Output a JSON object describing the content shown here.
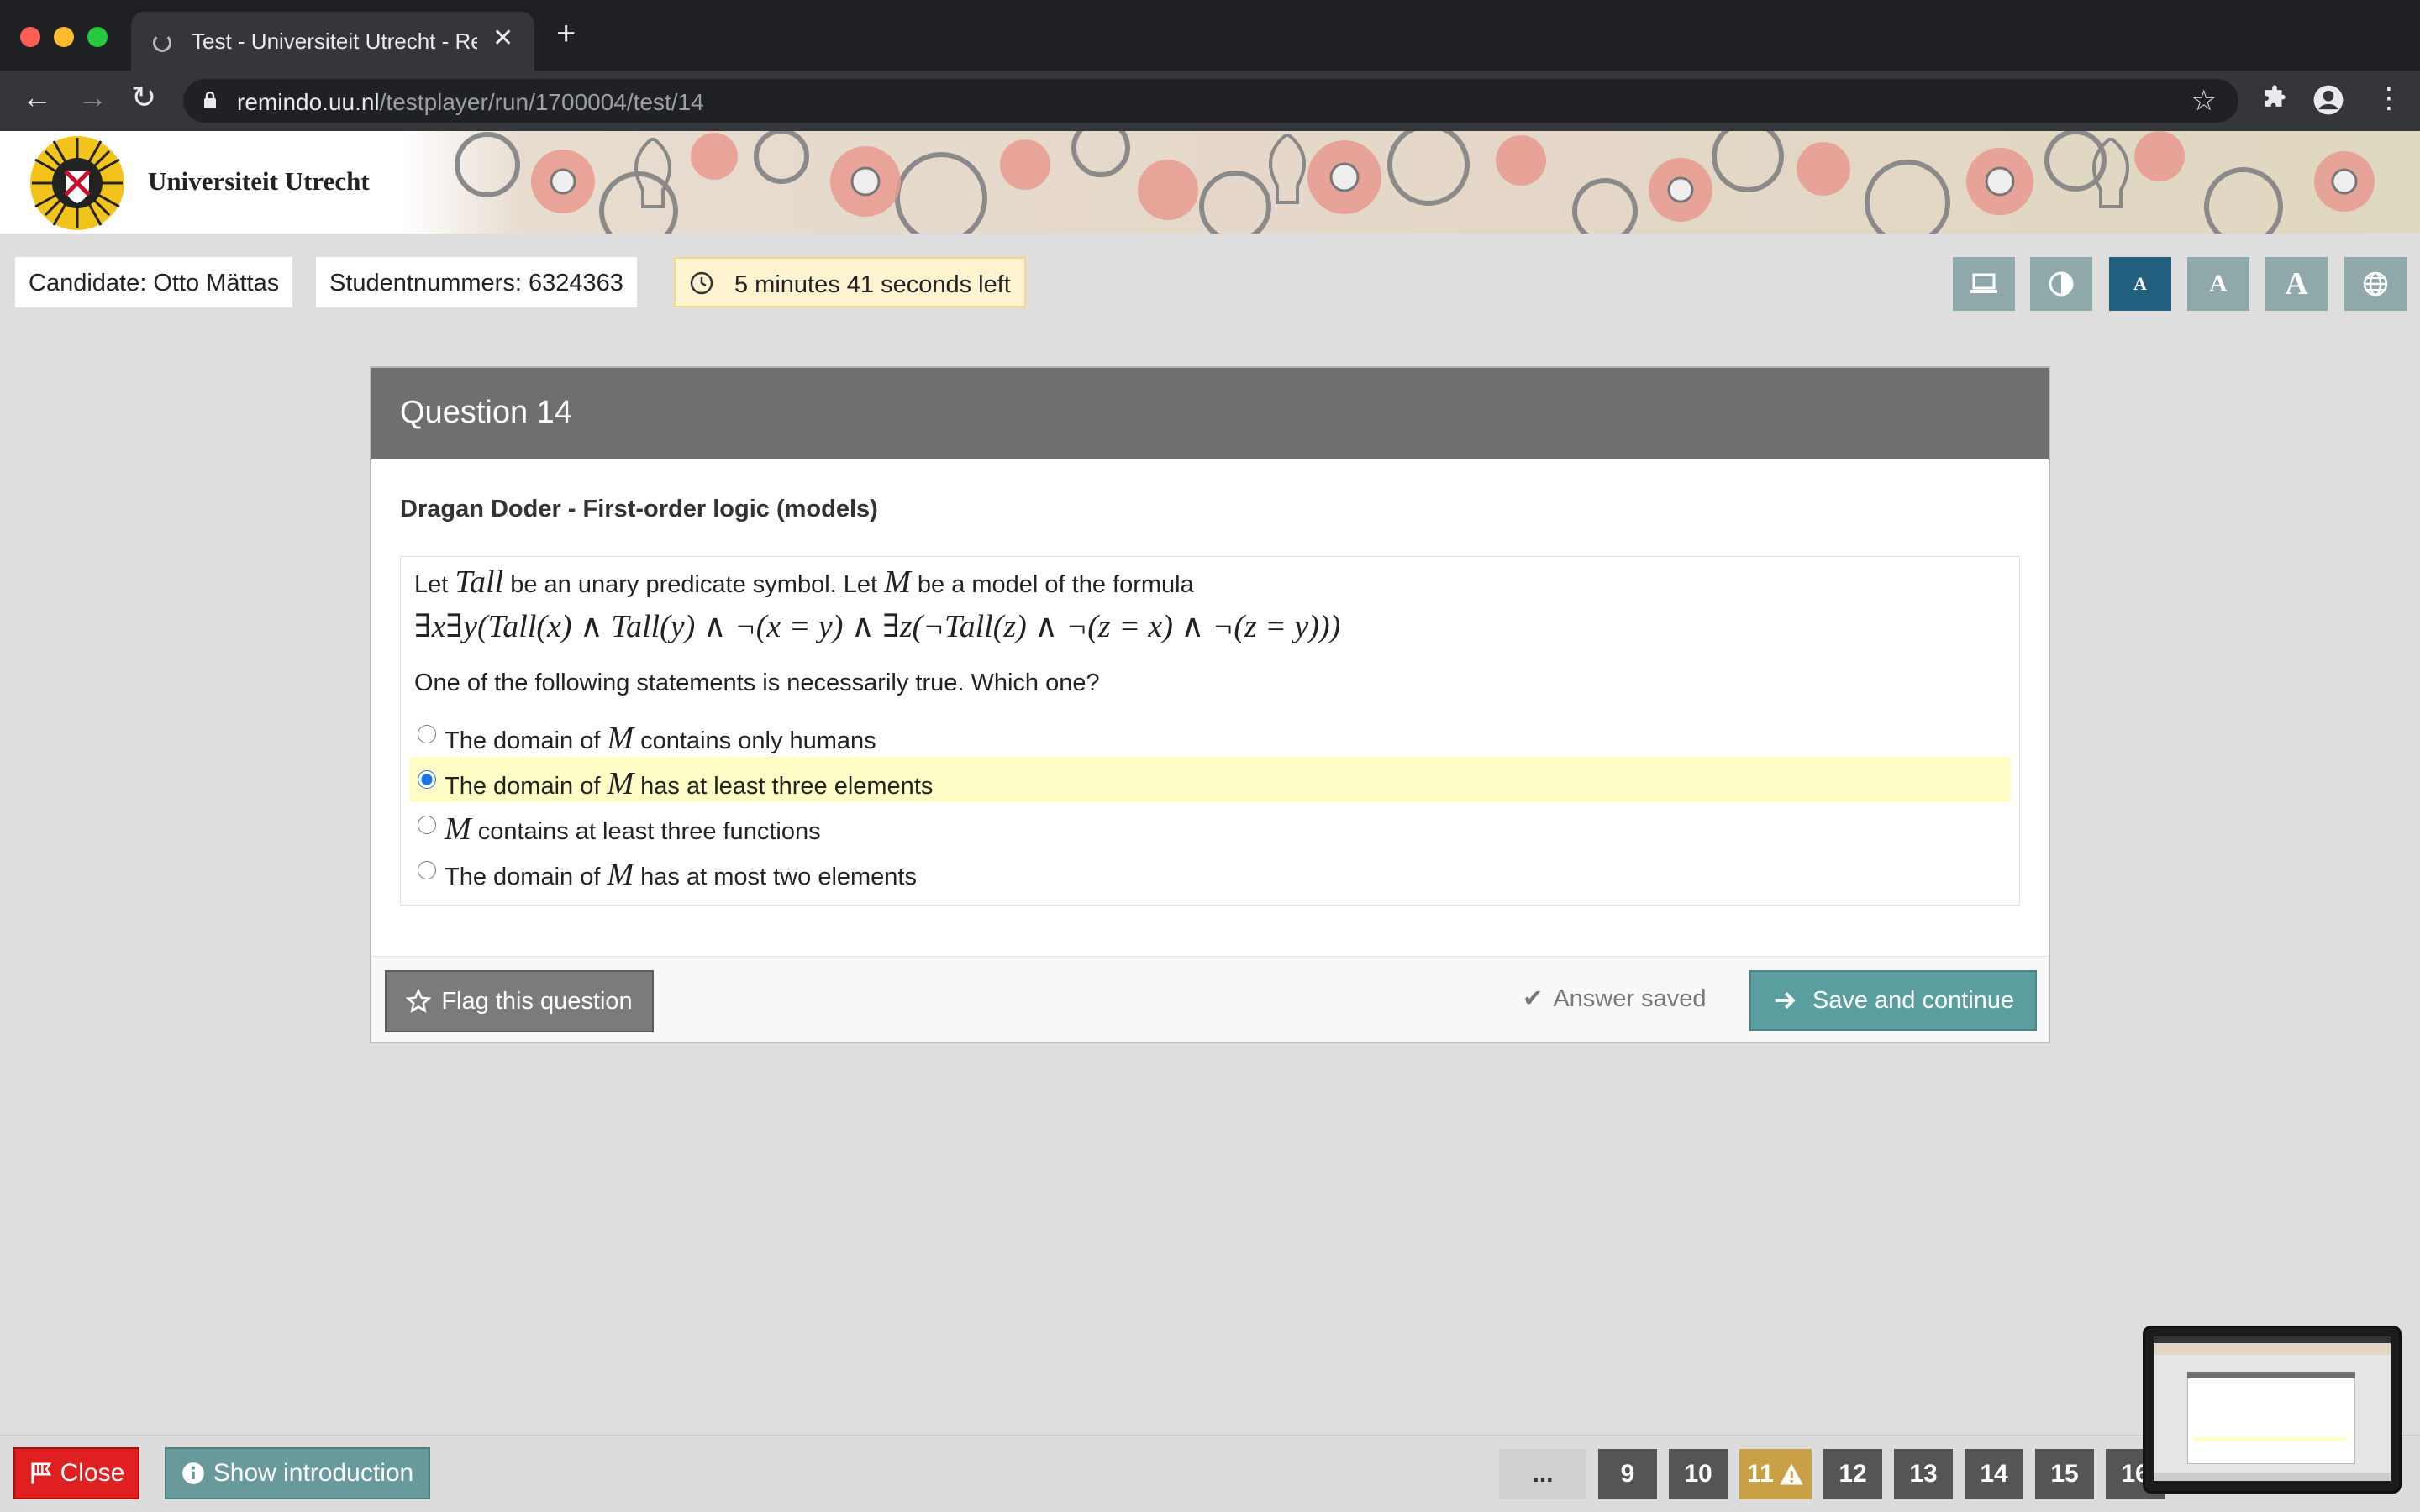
{
  "browser": {
    "tab_title": "Test - Universiteit Utrecht - Re",
    "url_host": "remindo.uu.nl",
    "url_path": "/testplayer/run/1700004/test/14"
  },
  "header": {
    "university_name": "Universiteit Utrecht"
  },
  "infobar": {
    "candidate": "Candidate: Otto Mättas",
    "student_number": "Studentnummers: 6324363",
    "time_left": "5 minutes 41 seconds left",
    "font_button_labels": [
      "A",
      "A",
      "A"
    ]
  },
  "question": {
    "title": "Question 14",
    "author": "Dragan Doder - First-order logic (models)",
    "intro_text": [
      "Let",
      "be an unary predicate symbol. Let",
      "be a model of the formula"
    ],
    "predicate_symbol": "Tall",
    "model_symbol": "M",
    "formula": "∃x∃y(Tall(x) ∧ Tall(y) ∧ ¬(x = y) ∧ ∃z(¬Tall(z) ∧ ¬(z = x) ∧ ¬(z = y)))",
    "prompt": "One of the following statements is necessarily true. Which one?",
    "options": [
      {
        "before": "The domain of",
        "symbol": "M",
        "after": "contains only humans",
        "selected": false
      },
      {
        "before": "The domain of",
        "symbol": "M",
        "after": "has at least three elements",
        "selected": true
      },
      {
        "before": "",
        "symbol": "M",
        "after": "contains at least three functions",
        "selected": false
      },
      {
        "before": "The domain of",
        "symbol": "M",
        "after": "has at most two elements",
        "selected": false
      }
    ]
  },
  "footer": {
    "flag_label": "Flag this question",
    "saved_status": "Answer saved",
    "save_label": "Save and continue"
  },
  "bottombar": {
    "close_label": "Close",
    "intro_label": "Show introduction",
    "pages": [
      "...",
      "9",
      "10",
      "11",
      "12",
      "13",
      "14",
      "15",
      "16"
    ],
    "current_page": "14",
    "warning_page": "11"
  },
  "colors": {
    "header_bg": "#6f6f6f",
    "selected_option_bg": "#fffec6",
    "save_button": "#5a9ea0",
    "close_button": "#e02020",
    "timer_bg": "#fdf3d0",
    "active_font_button": "#236080"
  }
}
